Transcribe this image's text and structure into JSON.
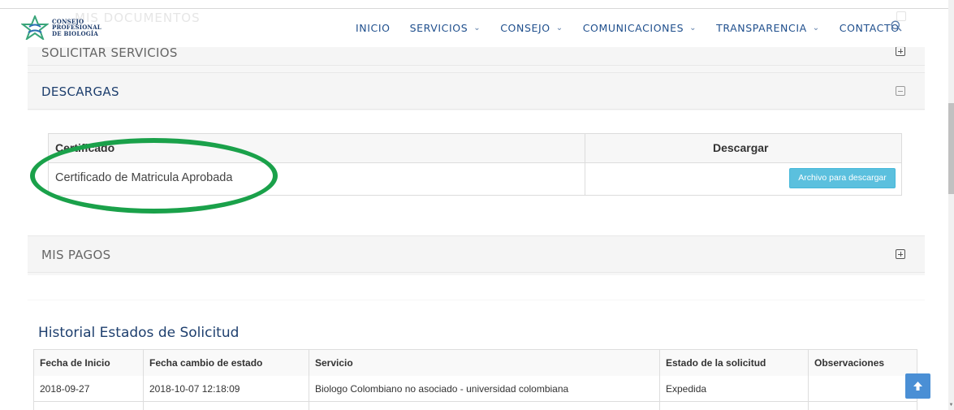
{
  "header": {
    "ghost_text": "MIS DOCUMENTOS",
    "logo_lines": [
      "CONSEJO",
      "PROFESIONAL",
      "DE BIOLOGÍA"
    ],
    "nav": [
      {
        "label": "INICIO",
        "dropdown": false
      },
      {
        "label": "SERVICIOS",
        "dropdown": true
      },
      {
        "label": "CONSEJO",
        "dropdown": true
      },
      {
        "label": "COMUNICACIONES",
        "dropdown": true
      },
      {
        "label": "TRANSPARENCIA",
        "dropdown": true
      },
      {
        "label": "CONTACTO",
        "dropdown": false
      }
    ],
    "search_icon": "search-icon"
  },
  "panels": {
    "solicitar": {
      "title": "SOLICITAR SERVICIOS",
      "state": "collapsed"
    },
    "descargas": {
      "title": "DESCARGAS",
      "state": "expanded",
      "table": {
        "headers": [
          "Certificado",
          "Descargar"
        ],
        "rows": [
          {
            "certificado": "Certificado de Matricula Aprobada",
            "button": "Archivo para descargar"
          }
        ]
      }
    },
    "pagos": {
      "title": "MIS PAGOS",
      "state": "collapsed"
    }
  },
  "history": {
    "title": "Historial Estados de Solicitud",
    "headers": [
      "Fecha de Inicio",
      "Fecha cambio de estado",
      "Servicio",
      "Estado de la solicitud",
      "Observaciones"
    ],
    "rows": [
      [
        "2018-09-27",
        "2018-10-07 12:18:09",
        "Biologo Colombiano no asociado - universidad colombiana",
        "Expedida",
        ""
      ]
    ]
  },
  "colors": {
    "title_blue": "#1e3f6e",
    "nav_blue": "#1f4f8d",
    "button_cyan": "#5bc0de",
    "highlight_green": "#1aa14a",
    "scroll_top_blue": "#4a8fd5"
  }
}
